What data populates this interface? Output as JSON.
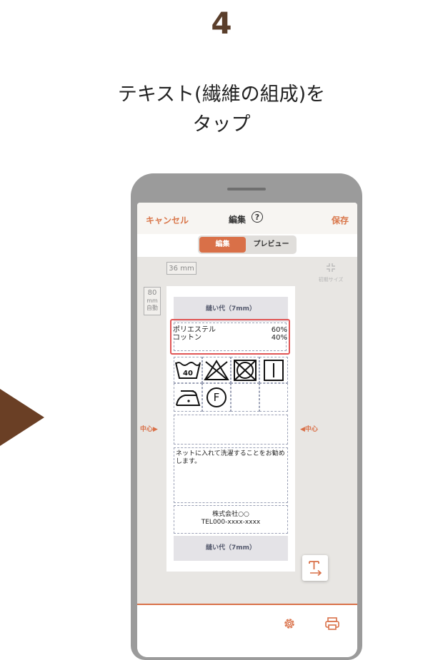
{
  "step": {
    "number": "4"
  },
  "instruction": {
    "line1": "テキスト(繊維の組成)を",
    "line2": "タップ"
  },
  "nav": {
    "cancel": "キャンセル",
    "title": "編集",
    "help": "?",
    "save": "保存"
  },
  "segment": {
    "edit": "編集",
    "preview": "プレビュー",
    "selected": "編集"
  },
  "canvas": {
    "width_chip": "36 mm",
    "length_chip": {
      "value": "80",
      "unit": "mm",
      "mode": "自動"
    },
    "reset_label": "初期サイズ",
    "center_left": "中心▶",
    "center_right": "◀中心"
  },
  "label": {
    "seam_top": "縫い代（7mm）",
    "seam_bottom": "縫い代（7mm）",
    "fibers": [
      {
        "name": "ポリエステル",
        "percent": "60%"
      },
      {
        "name": "コットン",
        "percent": "40%"
      }
    ],
    "wash_temp": "40",
    "dry_clean_letter": "F",
    "note": "ネットに入れて洗濯することをお勧めします。",
    "company": {
      "name": "株式会社○○",
      "tel": "TEL000-xxxx-xxxx"
    }
  },
  "icons": {
    "help": "help-circle-icon",
    "reset": "shrink-arrows-icon",
    "add_text": "add-text-icon",
    "settings": "gear-icon",
    "print": "printer-icon"
  },
  "colors": {
    "accent": "#d97048",
    "highlight": "#e05555",
    "step_number": "#5a3e2b",
    "arrow": "#6a3f25"
  }
}
